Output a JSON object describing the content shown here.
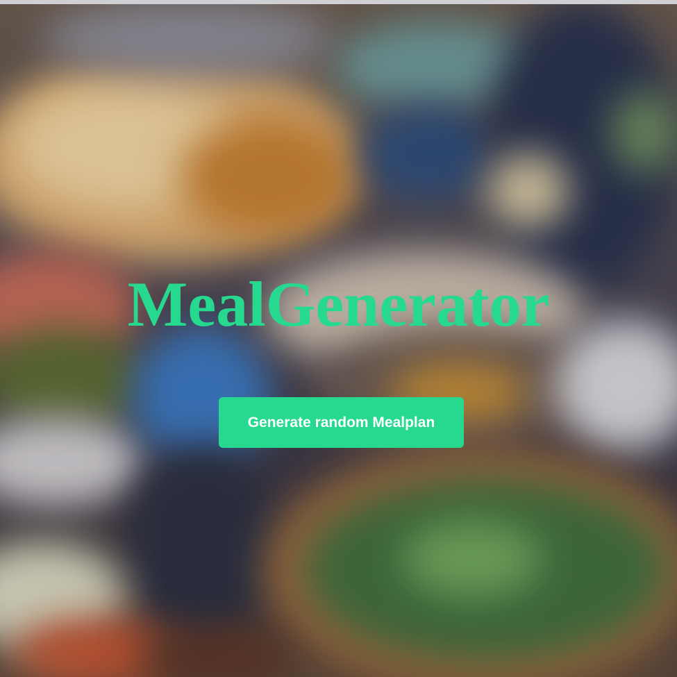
{
  "app": {
    "title": "MealGenerator"
  },
  "hero": {
    "button_label": "Generate random Mealplan"
  },
  "colors": {
    "accent": "#26d98f",
    "button_text": "#ffffff"
  }
}
